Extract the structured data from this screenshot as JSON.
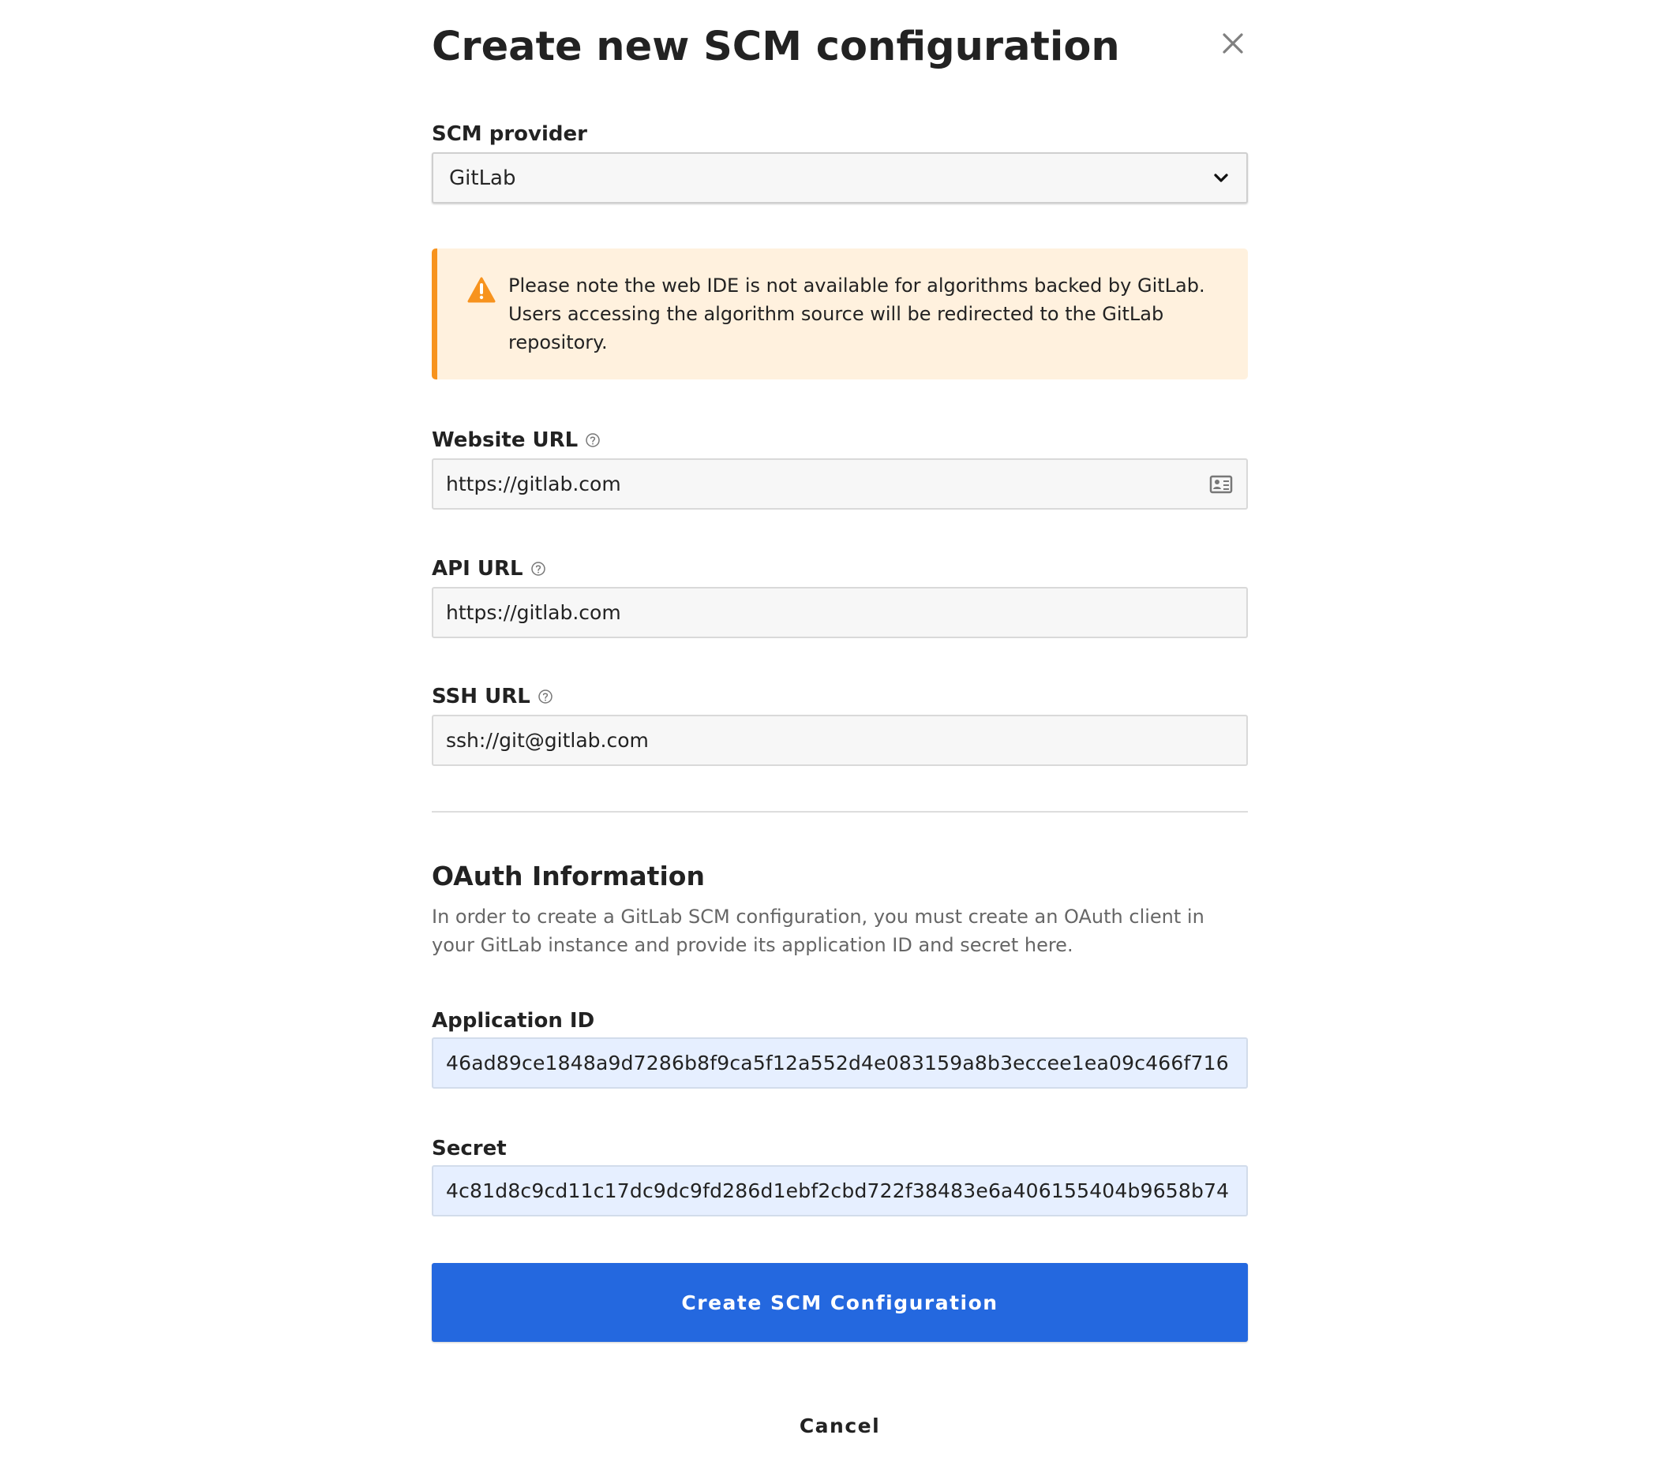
{
  "dialog": {
    "title": "Create new SCM configuration"
  },
  "fields": {
    "scm_provider": {
      "label": "SCM provider",
      "value": "GitLab"
    },
    "website_url": {
      "label": "Website URL",
      "value": "https://gitlab.com"
    },
    "api_url": {
      "label": "API URL",
      "value": "https://gitlab.com"
    },
    "ssh_url": {
      "label": "SSH URL",
      "value": "ssh://git@gitlab.com"
    }
  },
  "alert": {
    "message": "Please note the web IDE is not available for algorithms backed by GitLab. Users accessing the algorithm source will be redirected to the GitLab repository."
  },
  "oauth": {
    "title": "OAuth Information",
    "description": "In order to create a GitLab SCM configuration, you must create an OAuth client in your GitLab instance and provide its application ID and secret here.",
    "application_id": {
      "label": "Application ID",
      "value": "46ad89ce1848a9d7286b8f9ca5f12a552d4e083159a8b3eccee1ea09c466f716"
    },
    "secret": {
      "label": "Secret",
      "value": "4c81d8c9cd11c17dc9dc9fd286d1ebf2cbd722f38483e6a406155404b9658b74"
    }
  },
  "actions": {
    "create_label": "Create SCM Configuration",
    "cancel_label": "Cancel"
  },
  "icons": {
    "close": "close-icon",
    "select": "chevron-down-icon",
    "warning": "warning-icon",
    "help": "help-circle-icon",
    "contact_card": "contact-card-icon"
  },
  "colors": {
    "primary": "#2468df",
    "warning": "#f7931e",
    "warning_background": "#fff1de",
    "input_background": "#f7f7f7",
    "autofill_background": "#e6efff"
  }
}
